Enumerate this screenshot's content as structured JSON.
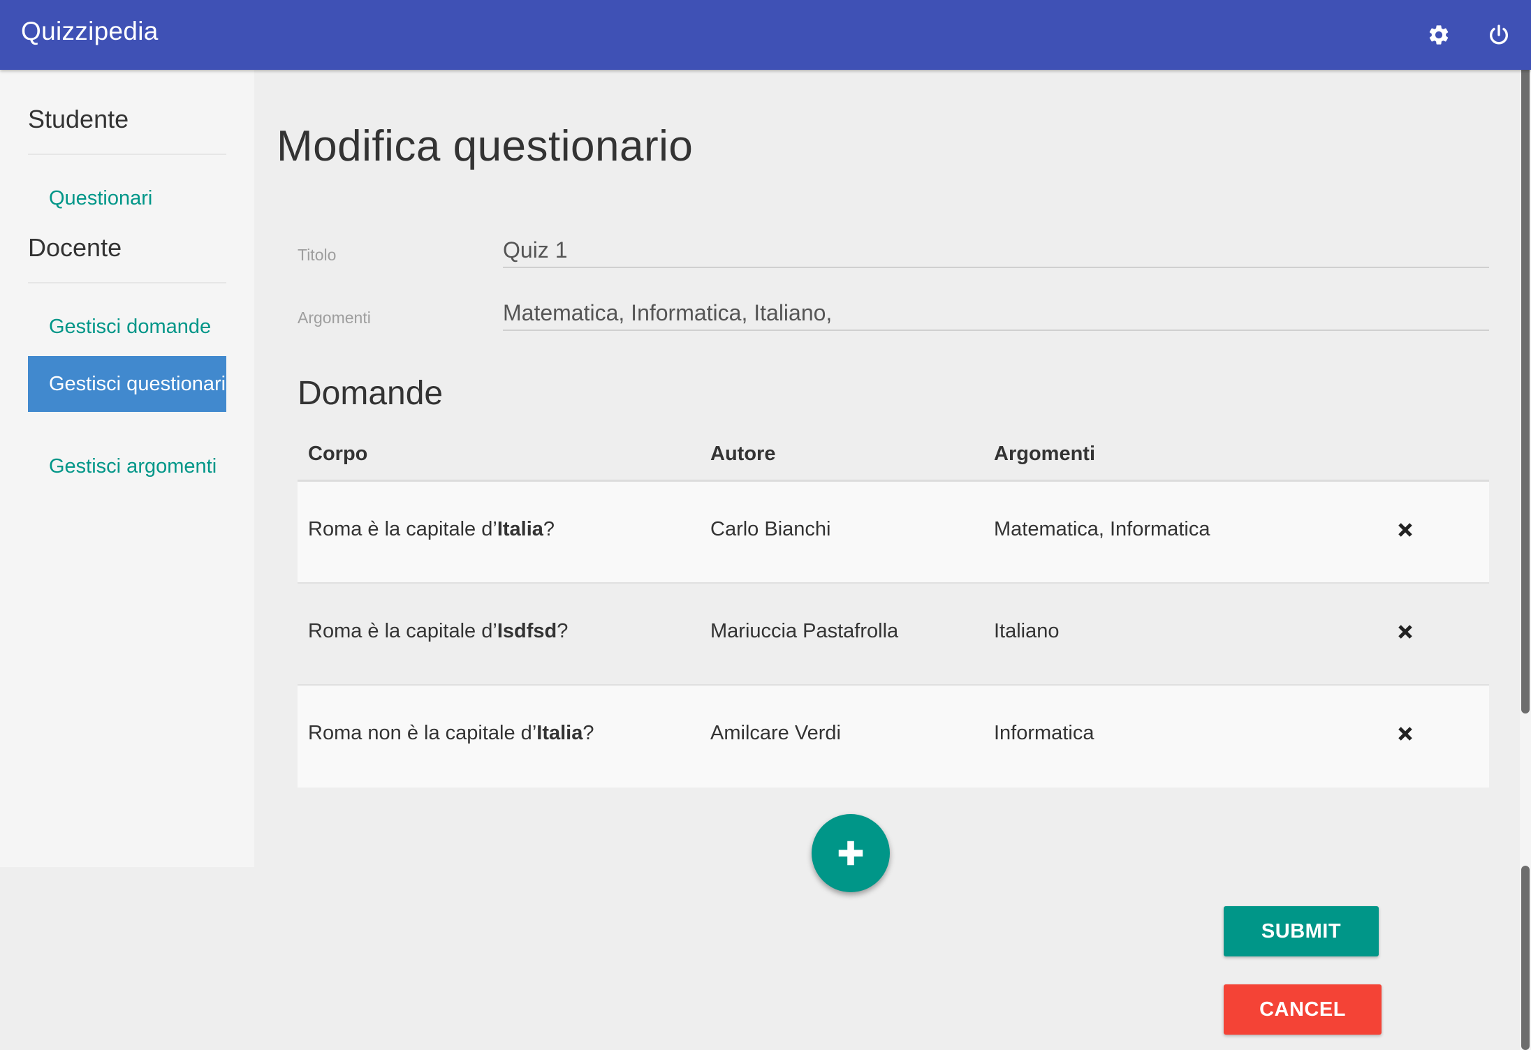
{
  "app": {
    "title": "Quizzipedia",
    "accent": "#3f51b5",
    "teal": "#009688",
    "red": "#f44336",
    "active_blue": "#4189ce"
  },
  "topbar_icons": {
    "settings": "gear-icon",
    "logout": "power-icon"
  },
  "sidebar": {
    "studente_title": "Studente",
    "studente_items": [
      {
        "label": "Questionari"
      }
    ],
    "docente_title": "Docente",
    "docente_items": [
      {
        "label": "Gestisci domande",
        "active": false
      },
      {
        "label": "Gestisci questionari",
        "active": true
      },
      {
        "label": "Gestisci argomenti",
        "active": false
      }
    ]
  },
  "main": {
    "title": "Modifica questionario",
    "fields": {
      "titolo_label": "Titolo",
      "titolo_value": "Quiz 1",
      "argomenti_label": "Argomenti",
      "argomenti_value": "Matematica, Informatica, Italiano,"
    },
    "section_title": "Domande",
    "table": {
      "headers": [
        "Corpo",
        "Autore",
        "Argomenti"
      ],
      "rows": [
        {
          "corpo_prefix": "Roma è la capitale d’",
          "corpo_bold": "Italia",
          "corpo_suffix": "?",
          "autore": "Carlo Bianchi",
          "argomenti": "Matematica, Informatica"
        },
        {
          "corpo_prefix": "Roma è la capitale d’",
          "corpo_bold": "Isdfsd",
          "corpo_suffix": "?",
          "autore": "Mariuccia Pastafrolla",
          "argomenti": "Italiano"
        },
        {
          "corpo_prefix": "Roma non è la capitale d’",
          "corpo_bold": "Italia",
          "corpo_suffix": "?",
          "autore": "Amilcare Verdi",
          "argomenti": "Informatica"
        }
      ]
    },
    "add_icon": "plus-icon",
    "submit_label": "SUBMIT",
    "cancel_label": "CANCEL"
  }
}
